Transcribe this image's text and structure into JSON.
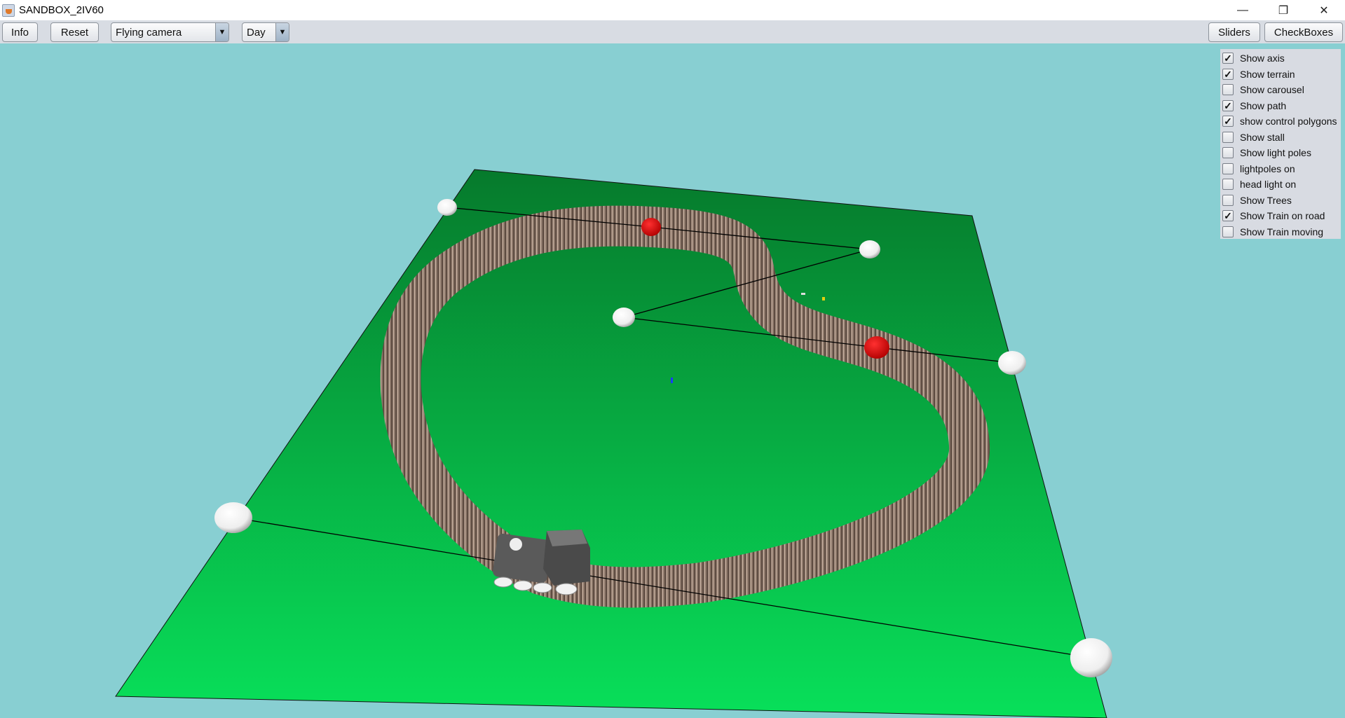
{
  "window": {
    "title": "SANDBOX_2IV60",
    "minimize": "—",
    "maximize": "❐",
    "close": "✕"
  },
  "toolbar": {
    "info": "Info",
    "reset": "Reset",
    "camera": "Flying camera",
    "time": "Day",
    "sliders": "Sliders",
    "checkboxes": "CheckBoxes",
    "dropdown_arrow": "▼"
  },
  "checkboxes": [
    {
      "label": "Show axis",
      "checked": true
    },
    {
      "label": "Show terrain",
      "checked": true
    },
    {
      "label": "Show carousel",
      "checked": false
    },
    {
      "label": "Show path",
      "checked": true
    },
    {
      "label": "show control polygons",
      "checked": true
    },
    {
      "label": "Show stall",
      "checked": false
    },
    {
      "label": "Show light poles",
      "checked": false
    },
    {
      "label": "lightpoles on",
      "checked": false
    },
    {
      "label": "head light on",
      "checked": false
    },
    {
      "label": "Show Trees",
      "checked": false
    },
    {
      "label": "Show Train on road",
      "checked": true
    },
    {
      "label": "Show Train moving",
      "checked": false
    }
  ],
  "colors": {
    "sky": "#88cfd2",
    "terrain": "#0a9a3a",
    "track": "#8a7466",
    "control_point": "#ffffff",
    "active_point": "#ff0000"
  }
}
